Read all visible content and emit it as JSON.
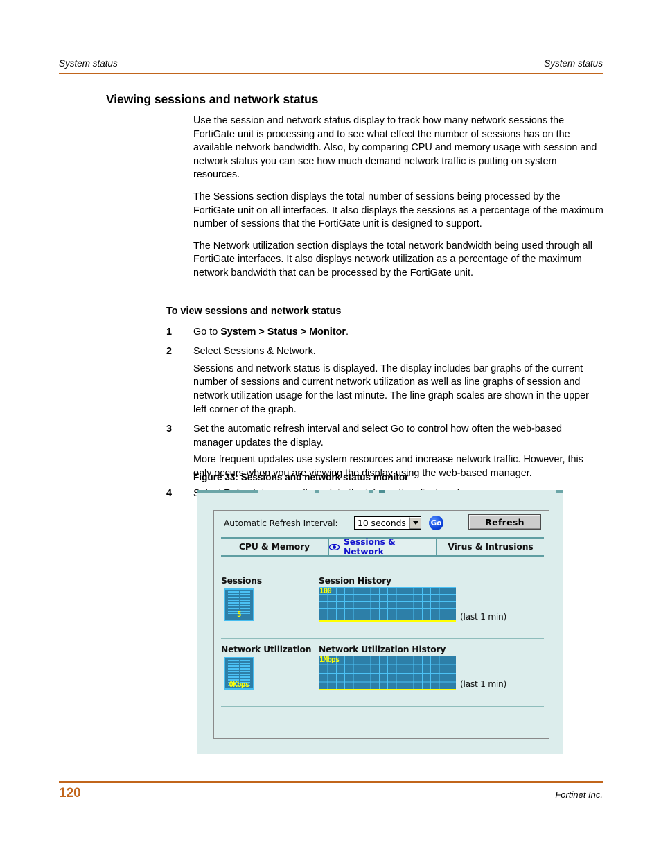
{
  "header": {
    "left": "System status",
    "right": "System status",
    "rule_color": "#c1651b"
  },
  "section_title": "Viewing sessions and network status",
  "paragraphs": [
    "Use the session and network status display to track how many network sessions the FortiGate unit is processing and to see what effect the number of sessions has on the available network bandwidth. Also, by comparing CPU and memory usage with session and network status you can see how much demand network traffic is putting on system resources.",
    "The Sessions section displays the total number of sessions being processed by the FortiGate unit on all interfaces. It also displays the sessions as a percentage of the maximum number of sessions that the FortiGate unit is designed to support.",
    "The Network utilization section displays the total network bandwidth being used through all FortiGate interfaces. It also displays network utilization as a percentage of the maximum network bandwidth that can be processed by the FortiGate unit."
  ],
  "procedure_heading": "To view sessions and network status",
  "steps": [
    {
      "num": "1",
      "lines": [
        "Go to System > Status > Monitor."
      ]
    },
    {
      "num": "2",
      "lines": [
        "Select Sessions & Network.",
        "Sessions and network status is displayed. The display includes bar graphs of the current number of sessions and current network utilization as well as line graphs of session and network utilization usage for the last minute. The line graph scales are shown in the upper left corner of the graph."
      ]
    },
    {
      "num": "3",
      "lines": [
        "Set the automatic refresh interval and select Go to control how often the web-based manager updates the display.",
        "More frequent updates use system resources and increase network traffic. However, this only occurs when you are viewing the display using the web-based manager."
      ]
    },
    {
      "num": "4",
      "lines": [
        "Select Refresh to manually update the information displayed."
      ]
    }
  ],
  "figure_caption": "Figure 33: Sessions and network status monitor",
  "figure": {
    "refresh_label": "Automatic Refresh Interval:",
    "interval_value": "10 seconds",
    "interval_options": [
      "10 seconds"
    ],
    "go_label": "Go",
    "refresh_button": "Refresh",
    "tabs": [
      {
        "label": "CPU & Memory",
        "active": false
      },
      {
        "label": "Sessions & Network",
        "active": true
      },
      {
        "label": "Virus & Intrusions",
        "active": false
      }
    ],
    "sessions": {
      "gauge_label": "Sessions",
      "gauge_value": "5",
      "history_label": "Session History",
      "history_scale": "100",
      "history_caption": "(last 1 min)"
    },
    "network": {
      "gauge_label": "Network Utilization",
      "gauge_value": "0Kbps",
      "history_label": "Network Utilization History",
      "history_scale": "1Mbps",
      "history_caption": "(last 1 min)"
    },
    "colors": {
      "background": "#dcedec",
      "graph_fill": "#2d7fa8",
      "graph_grid": "#4cc2f5",
      "graph_value": "#ffff00",
      "tab_rule": "#5f9ea2",
      "active_tab_text": "#1212cc"
    }
  },
  "footer": {
    "page_number": "120",
    "company": "Fortinet Inc."
  }
}
